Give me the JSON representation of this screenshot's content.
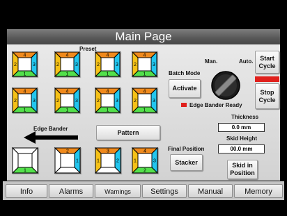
{
  "header": {
    "title": "Main Page"
  },
  "preset_section": {
    "label": "Preset"
  },
  "preset_tiles": [
    {
      "top": "4",
      "left": "2",
      "right": "3",
      "bottom": "1"
    },
    {
      "top": "4",
      "left": "2",
      "right": "3",
      "bottom": "1"
    },
    {
      "top": "4",
      "left": "2",
      "right": "3",
      "bottom": "1"
    },
    {
      "top": "4",
      "left": "2",
      "right": "3",
      "bottom": "1"
    },
    {
      "top": "4",
      "left": "2",
      "right": "3",
      "bottom": "1"
    },
    {
      "top": "4",
      "left": "2",
      "right": "3",
      "bottom": "1"
    },
    {
      "top": "4",
      "left": "2",
      "right": "3",
      "bottom": "1"
    },
    {
      "top": "4",
      "left": "2",
      "right": "3",
      "bottom": "1"
    }
  ],
  "edge_bander": {
    "label": "Edge Bander"
  },
  "pattern_button": {
    "label": "Pattern"
  },
  "pattern_tiles": [
    {
      "top": "",
      "left": "",
      "right": "",
      "bottom": "1"
    },
    {
      "top": "2",
      "left": "",
      "right": "1",
      "bottom": ""
    },
    {
      "top": "3",
      "left": "1",
      "right": "2",
      "bottom": ""
    },
    {
      "top": "4",
      "left": "1",
      "right": "3",
      "bottom": "2"
    }
  ],
  "batch_mode": {
    "label": "Batch Mode",
    "button": "Activate"
  },
  "mode_switch": {
    "manual_label": "Man.",
    "auto_label": "Auto."
  },
  "start_cycle": {
    "line1": "Start",
    "line2": "Cycle"
  },
  "stop_cycle": {
    "line1": "Stop",
    "line2": "Cycle"
  },
  "status": {
    "text": "Edge Bander Ready",
    "color": "#e0201c"
  },
  "thickness": {
    "label": "Thickness",
    "value": "0.0 mm"
  },
  "skid_height": {
    "label": "Skid Height",
    "value": "00.0 mm"
  },
  "final_position": {
    "label": "Final Position",
    "button": "Stacker"
  },
  "skid_in_position": {
    "line1": "Skid in",
    "line2": "Position"
  },
  "tabs": [
    {
      "label": "Info"
    },
    {
      "label": "Alarms"
    },
    {
      "label": "Warnings"
    },
    {
      "label": "Settings"
    },
    {
      "label": "Manual"
    },
    {
      "label": "Memory"
    }
  ],
  "colors": {
    "orange": "#f08a1c",
    "yellow": "#f5c116",
    "cyan": "#22c6ee",
    "green": "#52e04c",
    "white": "#ffffff",
    "stop_bar": "#e0201c",
    "title_bar": "#5a5a5a"
  },
  "icons": {
    "mode_knob": "rotary-selector-icon",
    "edge_arrow": "arrow-left-icon",
    "status_led": "red-square-led"
  }
}
